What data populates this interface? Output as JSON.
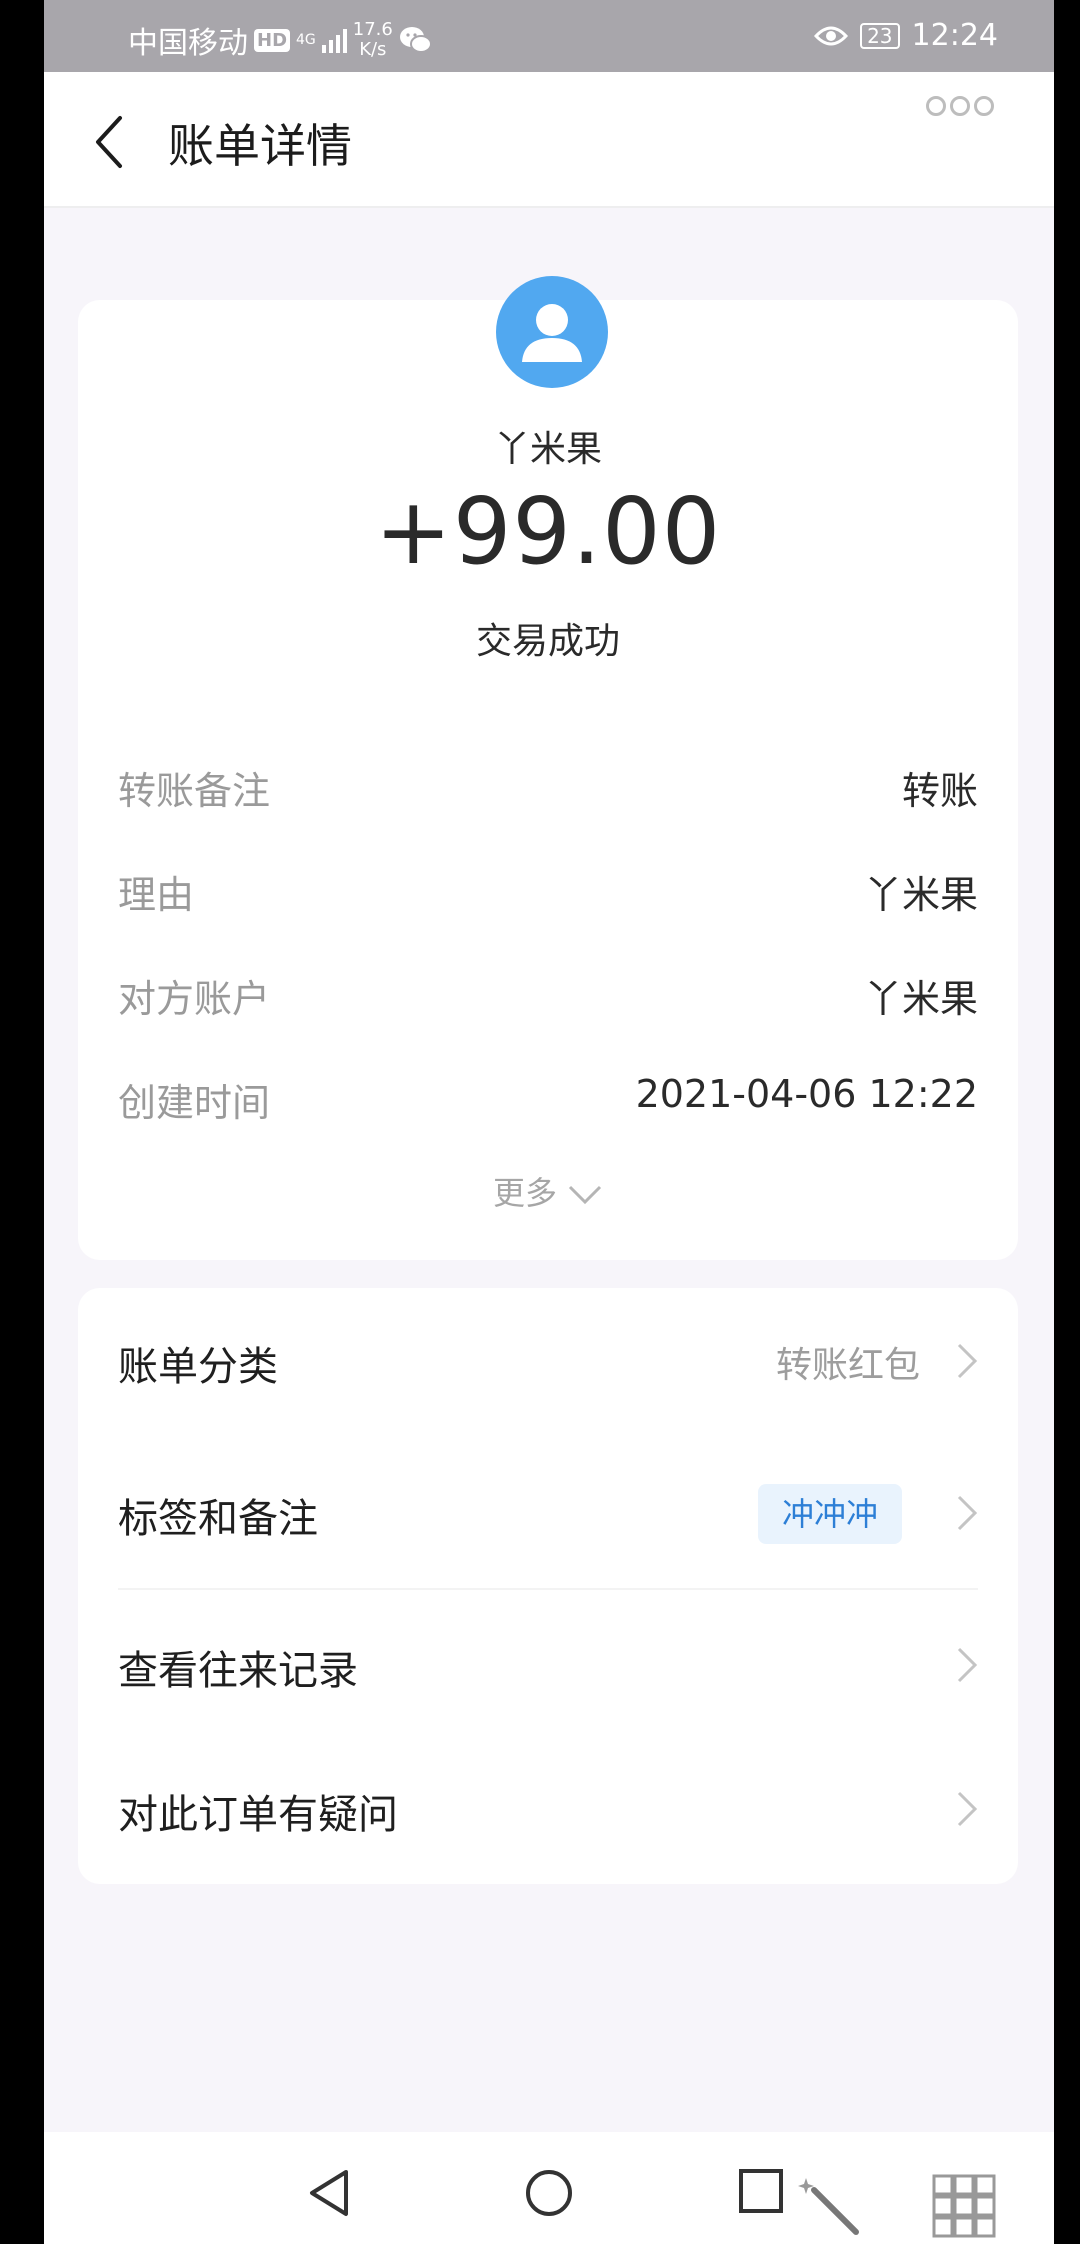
{
  "status_bar": {
    "carrier": "中国移动",
    "hd_badge": "HD",
    "network_type": "4G",
    "speed_value": "17.6",
    "speed_unit": "K/s",
    "battery": "23",
    "time": "12:24"
  },
  "header": {
    "title": "账单详情"
  },
  "summary": {
    "payee": "丫米果",
    "amount": "+99.00",
    "status": "交易成功",
    "details": [
      {
        "label": "转账备注",
        "value": "转账"
      },
      {
        "label": "理由",
        "value": "丫米果"
      },
      {
        "label": "对方账户",
        "value": "丫米果"
      },
      {
        "label": "创建时间",
        "value": "2021-04-06 12:22"
      }
    ],
    "more_label": "更多"
  },
  "menu": {
    "items": [
      {
        "label": "账单分类",
        "value": "转账红包"
      },
      {
        "label": "标签和备注",
        "tag": "冲冲冲"
      },
      {
        "label": "查看往来记录"
      },
      {
        "label": "对此订单有疑问"
      }
    ]
  },
  "colors": {
    "accent": "#51a8f0",
    "tag_text": "#2d7fd6",
    "tag_bg": "#e9f3fd",
    "status_bar": "#a8a6ab"
  }
}
